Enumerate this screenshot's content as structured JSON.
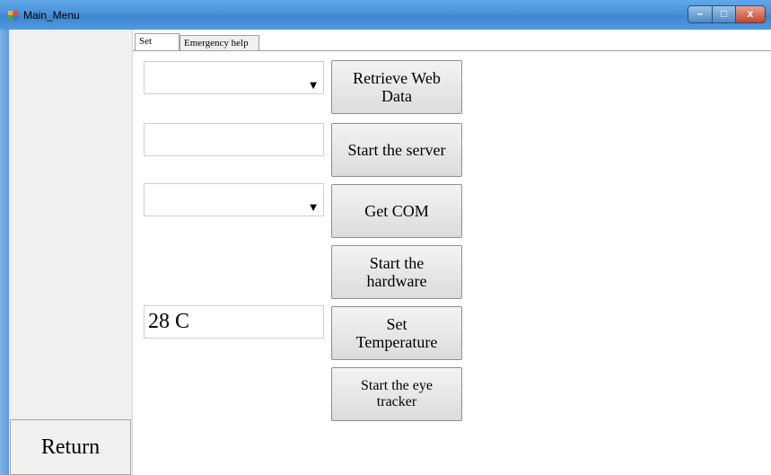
{
  "window": {
    "title": "Main_Menu",
    "minimize_label": "–",
    "maximize_label": "□",
    "close_label": "x"
  },
  "sidebar": {
    "return_label": "Return"
  },
  "tabs": [
    {
      "label": "Set",
      "active": true
    },
    {
      "label": "Emergency help",
      "active": false
    }
  ],
  "set_tab": {
    "web_data_select_value": "",
    "server_field_value": "",
    "com_select_value": "",
    "temperature_value": "28 C",
    "buttons": {
      "retrieve_web_data": "Retrieve Web\nData",
      "start_server": "Start the server",
      "get_com": "Get COM",
      "start_hardware": "Start the\nhardware",
      "set_temperature": "Set\nTemperature",
      "start_eye_tracker": "Start the eye\ntracker"
    }
  },
  "colors": {
    "titlebar": "#4a93db",
    "close_button": "#c2452a",
    "panel_bg": "#f0f0f0"
  }
}
